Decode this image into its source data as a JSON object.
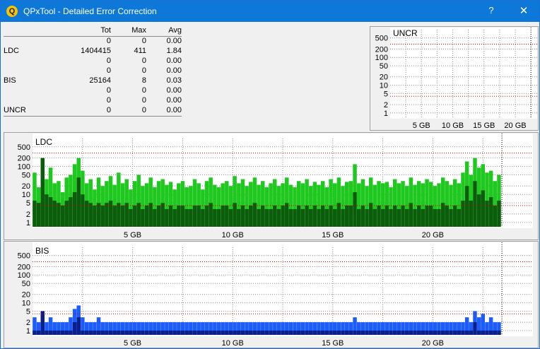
{
  "window": {
    "title": "QPxTool - Detailed Error Correction",
    "help_glyph": "?",
    "close_glyph": "✕",
    "icon_letter": "Q"
  },
  "stats": {
    "headers": [
      "",
      "Tot",
      "Max",
      "Avg"
    ],
    "rows": [
      {
        "label": "",
        "tot": "0",
        "max": "0",
        "avg": "0.00"
      },
      {
        "label": "LDC",
        "tot": "1404415",
        "max": "411",
        "avg": "1.84"
      },
      {
        "label": "",
        "tot": "0",
        "max": "0",
        "avg": "0.00"
      },
      {
        "label": "",
        "tot": "0",
        "max": "0",
        "avg": "0.00"
      },
      {
        "label": "BIS",
        "tot": "25164",
        "max": "8",
        "avg": "0.03"
      },
      {
        "label": "",
        "tot": "0",
        "max": "0",
        "avg": "0.00"
      },
      {
        "label": "",
        "tot": "0",
        "max": "0",
        "avg": "0.00"
      },
      {
        "label": "UNCR",
        "tot": "0",
        "max": "0",
        "avg": "0.00"
      }
    ]
  },
  "chart_data": [
    {
      "id": "uncr",
      "type": "bar",
      "title": "UNCR",
      "y_scale": "log",
      "y_ticks": [
        "1",
        "2",
        "5",
        "10",
        "20",
        "50",
        "100",
        "200",
        "500"
      ],
      "y_tick_values": [
        1,
        2,
        5,
        10,
        20,
        50,
        100,
        200,
        500
      ],
      "x_ticks": [
        "5 GB",
        "10 GB",
        "15 GB",
        "20 GB"
      ],
      "x_tick_values": [
        5,
        10,
        15,
        20
      ],
      "x_range": [
        0,
        23.5
      ],
      "end_marker_gb": 22.5,
      "threshold_lines": [
        300,
        4
      ],
      "series": [
        {
          "values": [],
          "color": "#2a8a2a"
        }
      ]
    },
    {
      "id": "ldc",
      "type": "bar",
      "title": "LDC",
      "y_scale": "log",
      "y_ticks": [
        "1",
        "2",
        "5",
        "10",
        "20",
        "50",
        "100",
        "200",
        "500"
      ],
      "y_tick_values": [
        1,
        2,
        5,
        10,
        20,
        50,
        100,
        200,
        500
      ],
      "x_ticks": [
        "5 GB",
        "10 GB",
        "15 GB",
        "20 GB"
      ],
      "x_tick_values": [
        5,
        10,
        15,
        20
      ],
      "x_range": [
        0,
        25
      ],
      "end_marker_gb": 23.45,
      "threshold_lines": [
        300,
        4
      ],
      "bins_gb": [
        0.2,
        0.4,
        0.6,
        0.8,
        1.0,
        1.2,
        1.4,
        1.6,
        1.8,
        2.0,
        2.2,
        2.4,
        2.6,
        2.8,
        3.0,
        3.2,
        3.4,
        3.6,
        3.8,
        4.0,
        4.2,
        4.4,
        4.6,
        4.8,
        5.0,
        5.2,
        5.4,
        5.6,
        5.8,
        6.0,
        6.2,
        6.4,
        6.6,
        6.8,
        7.0,
        7.2,
        7.4,
        7.6,
        7.8,
        8.0,
        8.2,
        8.4,
        8.6,
        8.8,
        9.0,
        9.2,
        9.4,
        9.6,
        9.8,
        10.0,
        10.2,
        10.4,
        10.6,
        10.8,
        11.0,
        11.2,
        11.4,
        11.6,
        11.8,
        12.0,
        12.2,
        12.4,
        12.6,
        12.8,
        13.0,
        13.2,
        13.4,
        13.6,
        13.8,
        14.0,
        14.2,
        14.4,
        14.6,
        14.8,
        15.0,
        15.2,
        15.4,
        15.6,
        15.8,
        16.0,
        16.2,
        16.4,
        16.6,
        16.8,
        17.0,
        17.2,
        17.4,
        17.6,
        17.8,
        18.0,
        18.2,
        18.4,
        18.6,
        18.8,
        19.0,
        19.2,
        19.4,
        19.6,
        19.8,
        20.0,
        20.2,
        20.4,
        20.6,
        20.8,
        21.0,
        21.2,
        21.4,
        21.6,
        21.8,
        22.0,
        22.2,
        22.4,
        22.6,
        22.8,
        23.0,
        23.2,
        23.4
      ],
      "series": [
        {
          "name": "",
          "color": "#1ec81e",
          "values": [
            60,
            18,
            140,
            35,
            90,
            25,
            30,
            12,
            40,
            50,
            120,
            200,
            70,
            25,
            35,
            15,
            40,
            20,
            30,
            45,
            22,
            60,
            25,
            35,
            15,
            30,
            50,
            20,
            25,
            40,
            18,
            30,
            35,
            22,
            28,
            15,
            25,
            30,
            18,
            20,
            35,
            25,
            15,
            30,
            40,
            22,
            18,
            25,
            30,
            20,
            45,
            25,
            35,
            20,
            28,
            40,
            22,
            30,
            18,
            25,
            35,
            20,
            25,
            40,
            22,
            18,
            30,
            25,
            35,
            20,
            28,
            22,
            30,
            18,
            35,
            25,
            40,
            20,
            28,
            30,
            120,
            25,
            35,
            20,
            40,
            22,
            30,
            25,
            28,
            18,
            35,
            25,
            30,
            20,
            40,
            22,
            30,
            25,
            35,
            28,
            20,
            25,
            40,
            30,
            22,
            35,
            25,
            60,
            150,
            50,
            200,
            90,
            120,
            60,
            70,
            30,
            50
          ]
        },
        {
          "name": "",
          "color": "#0b5d0b",
          "values": [
            6,
            5,
            200,
            10,
            8,
            6,
            5,
            4,
            6,
            8,
            12,
            40,
            10,
            6,
            5,
            4,
            5,
            4,
            5,
            6,
            4,
            5,
            4,
            5,
            3,
            4,
            5,
            3,
            4,
            5,
            3,
            4,
            5,
            3,
            4,
            3,
            4,
            4,
            3,
            3,
            4,
            4,
            3,
            4,
            5,
            3,
            3,
            4,
            4,
            3,
            5,
            3,
            4,
            3,
            4,
            5,
            3,
            4,
            3,
            3,
            4,
            3,
            4,
            5,
            3,
            3,
            4,
            3,
            4,
            3,
            4,
            3,
            4,
            3,
            4,
            3,
            5,
            3,
            4,
            4,
            12,
            3,
            4,
            3,
            5,
            3,
            4,
            3,
            4,
            3,
            4,
            3,
            4,
            3,
            5,
            3,
            4,
            3,
            4,
            4,
            3,
            3,
            5,
            4,
            3,
            4,
            3,
            6,
            20,
            6,
            30,
            10,
            14,
            6,
            8,
            4,
            6
          ]
        }
      ]
    },
    {
      "id": "bis",
      "type": "bar",
      "title": "BIS",
      "y_scale": "log",
      "y_ticks": [
        "1",
        "2",
        "5",
        "10",
        "20",
        "50",
        "100",
        "200",
        "500"
      ],
      "y_tick_values": [
        1,
        2,
        5,
        10,
        20,
        50,
        100,
        200,
        500
      ],
      "x_ticks": [
        "5 GB",
        "10 GB",
        "15 GB",
        "20 GB"
      ],
      "x_tick_values": [
        5,
        10,
        15,
        20
      ],
      "x_range": [
        0,
        25
      ],
      "end_marker_gb": 23.45,
      "threshold_lines": [
        300,
        4
      ],
      "bins_gb": [
        0.2,
        0.4,
        0.6,
        0.8,
        1.0,
        1.2,
        1.4,
        1.6,
        1.8,
        2.0,
        2.2,
        2.4,
        2.6,
        2.8,
        3.0,
        3.2,
        3.4,
        3.6,
        3.8,
        4.0,
        4.2,
        4.4,
        4.6,
        4.8,
        5.0,
        5.2,
        5.4,
        5.6,
        5.8,
        6.0,
        6.2,
        6.4,
        6.6,
        6.8,
        7.0,
        7.2,
        7.4,
        7.6,
        7.8,
        8.0,
        8.2,
        8.4,
        8.6,
        8.8,
        9.0,
        9.2,
        9.4,
        9.6,
        9.8,
        10.0,
        10.2,
        10.4,
        10.6,
        10.8,
        11.0,
        11.2,
        11.4,
        11.6,
        11.8,
        12.0,
        12.2,
        12.4,
        12.6,
        12.8,
        13.0,
        13.2,
        13.4,
        13.6,
        13.8,
        14.0,
        14.2,
        14.4,
        14.6,
        14.8,
        15.0,
        15.2,
        15.4,
        15.6,
        15.8,
        16.0,
        16.2,
        16.4,
        16.6,
        16.8,
        17.0,
        17.2,
        17.4,
        17.6,
        17.8,
        18.0,
        18.2,
        18.4,
        18.6,
        18.8,
        19.0,
        19.2,
        19.4,
        19.6,
        19.8,
        20.0,
        20.2,
        20.4,
        20.6,
        20.8,
        21.0,
        21.2,
        21.4,
        21.6,
        21.8,
        22.0,
        22.2,
        22.4,
        22.6,
        22.8,
        23.0,
        23.2,
        23.4
      ],
      "series": [
        {
          "name": "",
          "color": "#1c5cff",
          "values": [
            3,
            2,
            5,
            2,
            3,
            2,
            2,
            2,
            2,
            3,
            6,
            8,
            3,
            2,
            2,
            2,
            3,
            2,
            2,
            2,
            2,
            2,
            2,
            2,
            2,
            2,
            2,
            2,
            2,
            2,
            2,
            2,
            2,
            2,
            2,
            2,
            2,
            2,
            2,
            2,
            2,
            2,
            2,
            2,
            2,
            2,
            2,
            2,
            2,
            2,
            2,
            2,
            2,
            2,
            2,
            2,
            2,
            2,
            2,
            2,
            2,
            2,
            2,
            2,
            2,
            2,
            2,
            2,
            2,
            2,
            2,
            2,
            2,
            2,
            2,
            2,
            2,
            2,
            2,
            2,
            3,
            2,
            2,
            2,
            2,
            2,
            2,
            2,
            2,
            2,
            2,
            2,
            2,
            2,
            2,
            2,
            2,
            2,
            2,
            2,
            2,
            2,
            2,
            2,
            2,
            2,
            2,
            2,
            3,
            2,
            5,
            3,
            4,
            2,
            3,
            2,
            2
          ]
        },
        {
          "name": "",
          "color": "#0a1f8a",
          "values": [
            1,
            1,
            5,
            1,
            1,
            1,
            1,
            1,
            1,
            1,
            2,
            3,
            1,
            1,
            1,
            1,
            1,
            1,
            1,
            1,
            1,
            1,
            1,
            1,
            1,
            1,
            1,
            1,
            1,
            1,
            1,
            1,
            1,
            1,
            1,
            1,
            1,
            1,
            1,
            1,
            1,
            1,
            1,
            1,
            1,
            1,
            1,
            1,
            1,
            1,
            1,
            1,
            1,
            1,
            1,
            1,
            1,
            1,
            1,
            1,
            1,
            1,
            1,
            1,
            1,
            1,
            1,
            1,
            1,
            1,
            1,
            1,
            1,
            1,
            1,
            1,
            1,
            1,
            1,
            1,
            1,
            1,
            1,
            1,
            1,
            1,
            1,
            1,
            1,
            1,
            1,
            1,
            1,
            1,
            1,
            1,
            1,
            1,
            1,
            1,
            1,
            1,
            1,
            1,
            1,
            1,
            1,
            1,
            1,
            1,
            2,
            1,
            1,
            1,
            1,
            1,
            1
          ]
        }
      ]
    }
  ],
  "colors": {
    "titlebar": "#0e78d8",
    "threshold": "#c00000",
    "grid": "#8c8c8c"
  }
}
